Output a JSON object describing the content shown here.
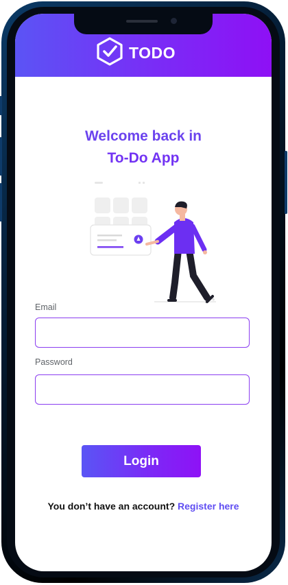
{
  "app": {
    "brand_name": "TODO",
    "logo_icon": "checkmark-hexagon-icon"
  },
  "welcome": {
    "line1": "Welcome back in",
    "line2": "To-Do App"
  },
  "illustration": {
    "icon": "person-pressing-button-illustration"
  },
  "form": {
    "email_label": "Email",
    "email_value": "",
    "password_label": "Password",
    "password_value": ""
  },
  "login_button": {
    "label": "Login"
  },
  "register": {
    "prompt": "You don’t have an account?",
    "link": "Register here"
  },
  "colors": {
    "accent": "#6f3ef2",
    "header_start": "#5b54f5",
    "header_end": "#8e10f5",
    "field_border": "#8a3cf0"
  }
}
